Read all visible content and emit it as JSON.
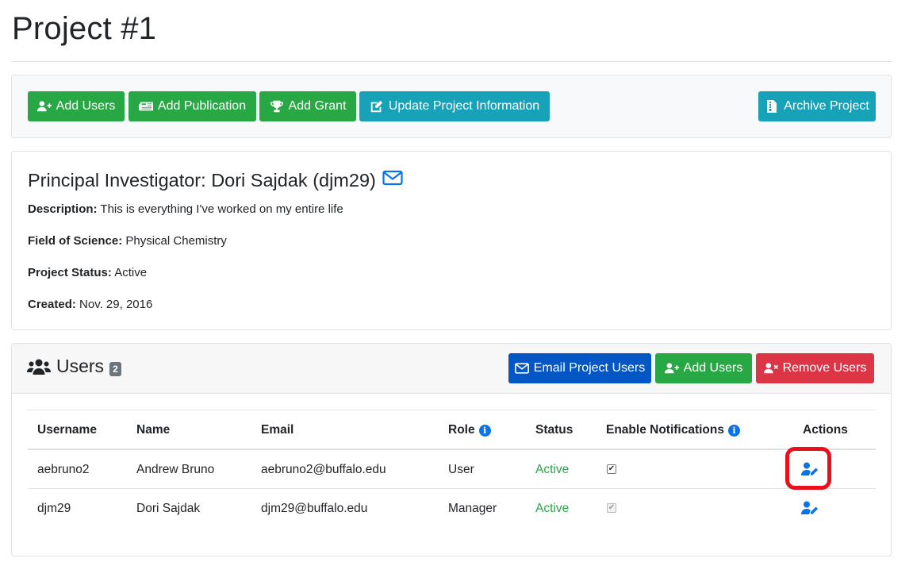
{
  "page": {
    "title": "Project #1"
  },
  "toolbar": {
    "add_users": "Add Users",
    "add_publication": "Add Publication",
    "add_grant": "Add Grant",
    "update_info": "Update Project Information",
    "archive": "Archive Project"
  },
  "info": {
    "pi_heading": "Principal Investigator: Dori Sajdak (djm29)",
    "description_label": "Description:",
    "description_value": "This is everything I've worked on my entire life",
    "field_label": "Field of Science:",
    "field_value": "Physical Chemistry",
    "status_label": "Project Status:",
    "status_value": "Active",
    "created_label": "Created:",
    "created_value": "Nov. 29, 2016"
  },
  "users": {
    "title": "Users",
    "count": "2",
    "email_button": "Email Project Users",
    "add_button": "Add Users",
    "remove_button": "Remove Users",
    "columns": {
      "username": "Username",
      "name": "Name",
      "email": "Email",
      "role": "Role",
      "status": "Status",
      "notifications": "Enable Notifications",
      "actions": "Actions"
    },
    "rows": [
      {
        "username": "aebruno2",
        "name": "Andrew Bruno",
        "email": "aebruno2@buffalo.edu",
        "role": "User",
        "status": "Active",
        "notifications": true,
        "notifications_disabled": false
      },
      {
        "username": "djm29",
        "name": "Dori Sajdak",
        "email": "djm29@buffalo.edu",
        "role": "Manager",
        "status": "Active",
        "notifications": true,
        "notifications_disabled": true
      }
    ]
  },
  "colors": {
    "success": "#28a745",
    "info": "#17a2b8",
    "primary": "#0456c4",
    "danger": "#dc3545",
    "icon_blue": "#0c72e8",
    "highlight": "#e8101b"
  }
}
